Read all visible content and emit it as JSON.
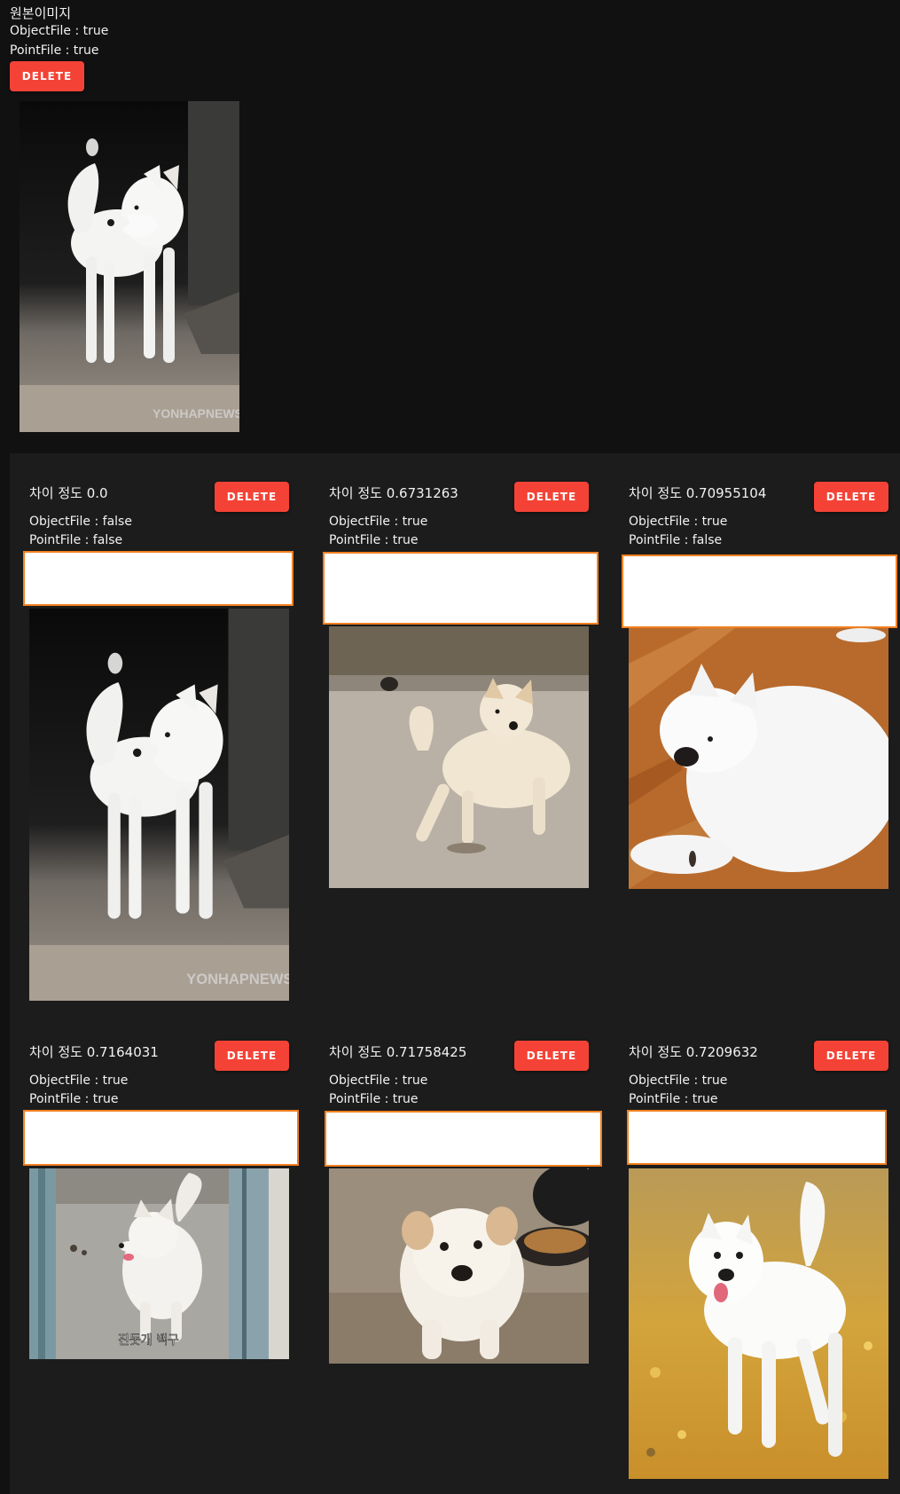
{
  "original": {
    "title": "원본이미지",
    "object_file": "ObjectFile : true",
    "point_file": "PointFile : true",
    "delete_label": "DELETE"
  },
  "results": [
    {
      "label": "차이 정도 0.0",
      "object_file": "ObjectFile : false",
      "point_file": "PointFile : false",
      "delete_label": "DELETE"
    },
    {
      "label": "차이 정도 0.6731263",
      "object_file": "ObjectFile : true",
      "point_file": "PointFile : true",
      "delete_label": "DELETE"
    },
    {
      "label": "차이 정도 0.70955104",
      "object_file": "ObjectFile : true",
      "point_file": "PointFile : false",
      "delete_label": "DELETE"
    },
    {
      "label": "차이 정도 0.7164031",
      "object_file": "ObjectFile : true",
      "point_file": "PointFile : true",
      "delete_label": "DELETE",
      "caption": "진돗개 백구"
    },
    {
      "label": "차이 정도 0.71758425",
      "object_file": "ObjectFile : true",
      "point_file": "PointFile : true",
      "delete_label": "DELETE"
    },
    {
      "label": "차이 정도 0.7209632",
      "object_file": "ObjectFile : true",
      "point_file": "PointFile : true",
      "delete_label": "DELETE"
    }
  ],
  "watermark": "YONHAPNEWS",
  "colors": {
    "delete_button": "#f44336",
    "mask_border": "#f28020",
    "background": "#111111",
    "panel": "#1c1c1c"
  }
}
